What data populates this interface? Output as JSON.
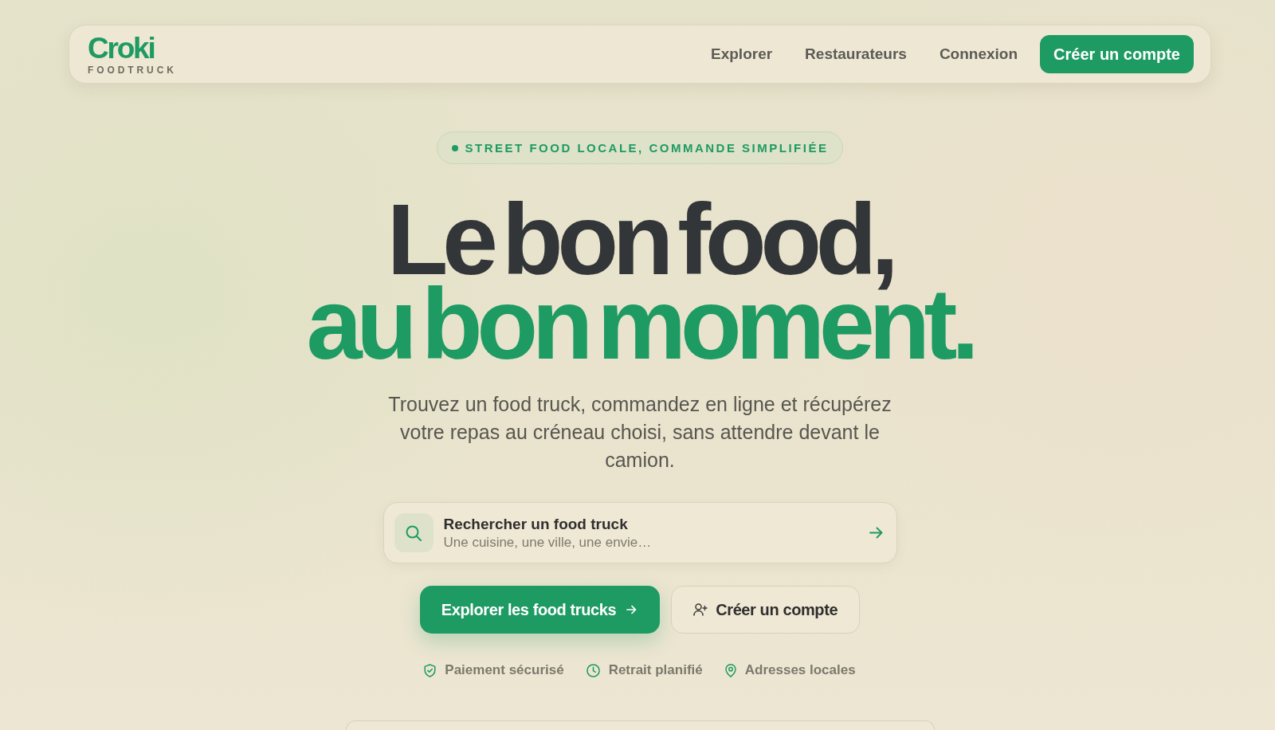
{
  "nav": {
    "logo": "Croki",
    "logo_subtitle": "FOODTRUCK",
    "links": [
      {
        "label": "Explorer"
      },
      {
        "label": "Restaurateurs"
      },
      {
        "label": "Connexion"
      }
    ],
    "cta": "Créer un compte"
  },
  "hero": {
    "badge": "STREET FOOD LOCALE, COMMANDE SIMPLIFIÉE",
    "title": "Le bon food,",
    "title_accent": "au bon moment.",
    "description": "Trouvez un food truck, commandez en ligne et récupérez votre repas au créneau choisi, sans attendre devant le camion.",
    "search": {
      "label": "Rechercher un food truck",
      "placeholder": "Une cuisine, une ville, une envie…"
    },
    "buttons": [
      {
        "kind": "primary",
        "label": "Explorer les food trucks"
      },
      {
        "kind": "secondary",
        "label": "Créer un compte"
      }
    ],
    "features": [
      {
        "kind": "shield",
        "label": "Paiement sécurisé"
      },
      {
        "kind": "clock",
        "label": "Retrait planifié"
      },
      {
        "kind": "pin",
        "label": "Adresses locales"
      }
    ]
  }
}
